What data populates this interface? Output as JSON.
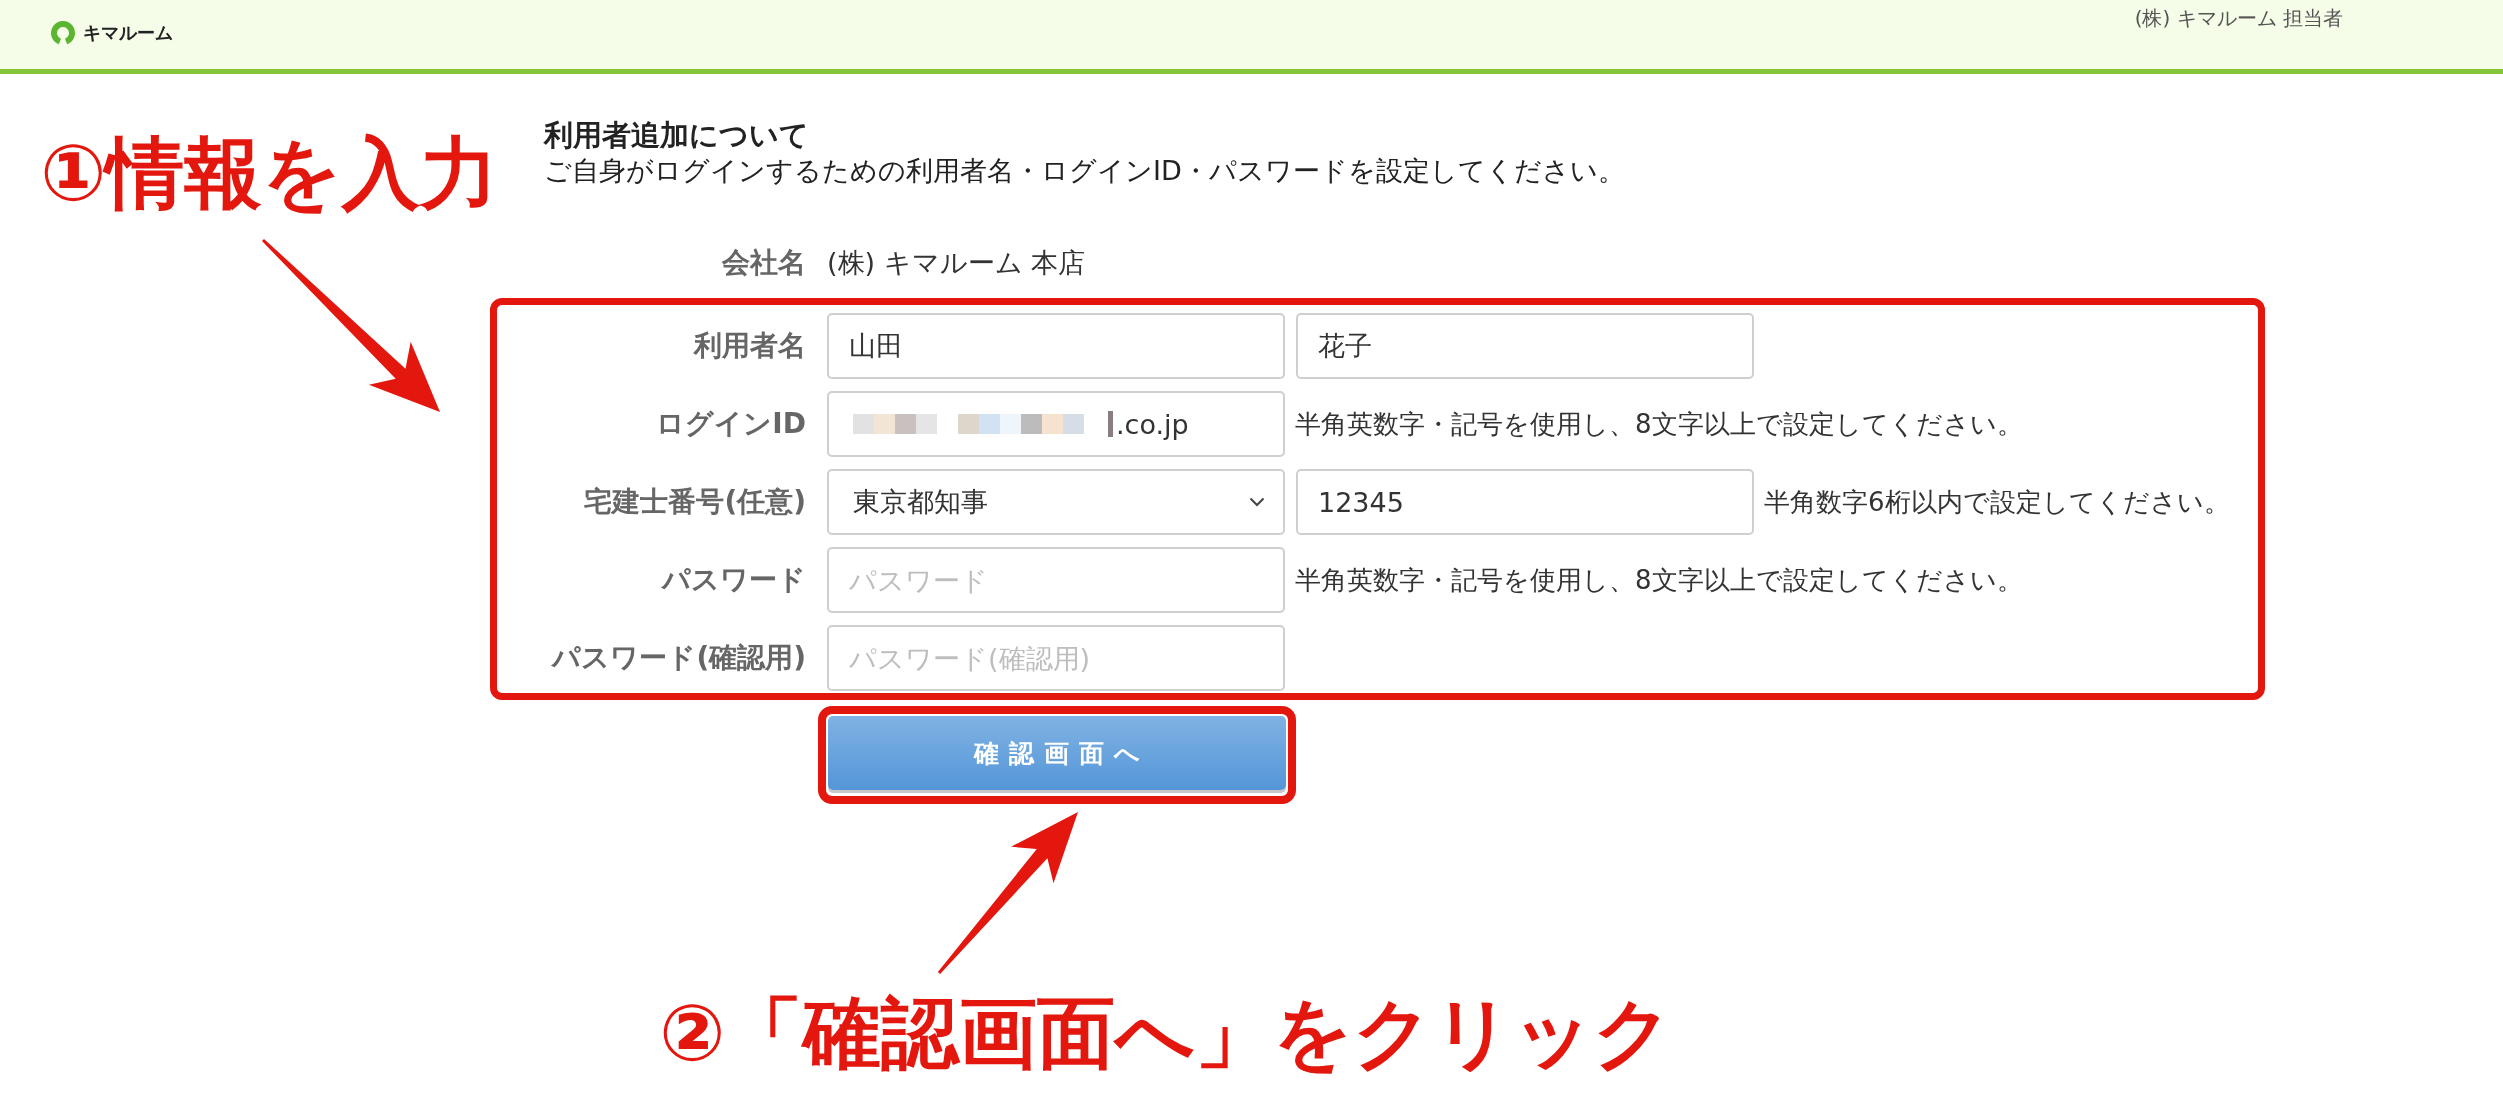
{
  "header": {
    "brand": "キマルーム",
    "account": "(株) キマルーム 担当者"
  },
  "intro": {
    "title": "利用者追加について",
    "description": "ご自身がログインするための利用者名・ログインID・パスワードを設定してください。"
  },
  "company": {
    "label": "会社名",
    "value": "(株) キマルーム 本店"
  },
  "form": {
    "highlighted": true,
    "rows": [
      {
        "label": "利用者名",
        "controls": [
          {
            "kind": "text",
            "value": "山田"
          },
          {
            "kind": "text",
            "value": "花子"
          }
        ]
      },
      {
        "label": "ログインID",
        "controls": [
          {
            "kind": "redacted",
            "value": ".co.jp"
          }
        ],
        "hint": "半角英数字・記号を使用し、8文字以上で設定してください。"
      },
      {
        "label": "宅建士番号(任意)",
        "controls": [
          {
            "kind": "select",
            "value": "東京都知事"
          },
          {
            "kind": "text",
            "value": "12345"
          }
        ],
        "hint": "半角数字6桁以内で設定してください。"
      },
      {
        "label": "パスワード",
        "controls": [
          {
            "kind": "password",
            "placeholder": "パスワード"
          }
        ],
        "hint": "半角英数字・記号を使用し、8文字以上で設定してください。"
      },
      {
        "label": "パスワード(確認用)",
        "controls": [
          {
            "kind": "password",
            "placeholder": "パスワード(確認用)"
          }
        ]
      }
    ]
  },
  "submit_button": {
    "label": "確認画面へ",
    "highlighted": true
  },
  "callouts": [
    {
      "text": "①情報を入力"
    },
    {
      "text": "②「確認画面へ」をクリック"
    }
  ]
}
